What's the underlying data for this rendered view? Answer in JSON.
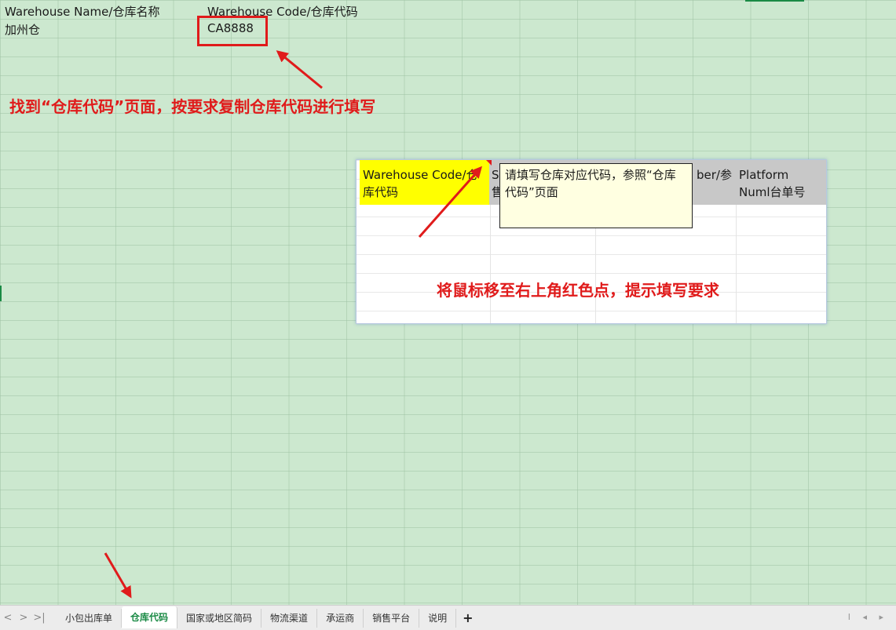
{
  "sheet": {
    "cells": {
      "a1": "Warehouse Name/仓库名称",
      "b1": "Warehouse Code/仓库代码",
      "a2": "加州仓",
      "b2": "CA8888"
    }
  },
  "annotations": {
    "top": "找到“仓库代码”页面，按要求复制仓库代码进行填写",
    "middle": "将鼠标移至右上角红色点，提示填写要求",
    "color": "#e01b1b"
  },
  "excerpt": {
    "headers": [
      "Warehouse Code/仓库代码",
      "Sa售",
      "ber/参",
      "Platform Numl台单号"
    ],
    "header_colors": [
      "#ffff00",
      "#c8c8c8",
      "#c8c8c8",
      "#c8c8c8"
    ],
    "comment": "请填写仓库对应代码，参照“仓库代码”页面"
  },
  "tabs": {
    "nav": [
      "<",
      ">",
      ">|"
    ],
    "items": [
      "小包出库单",
      "仓库代码",
      "国家或地区简码",
      "物流渠道",
      "承运商",
      "销售平台",
      "说明"
    ],
    "active": "仓库代码",
    "add_label": "+"
  },
  "colors": {
    "sheet_bg": "#cce8cf",
    "accent_green": "#1a8a45"
  }
}
